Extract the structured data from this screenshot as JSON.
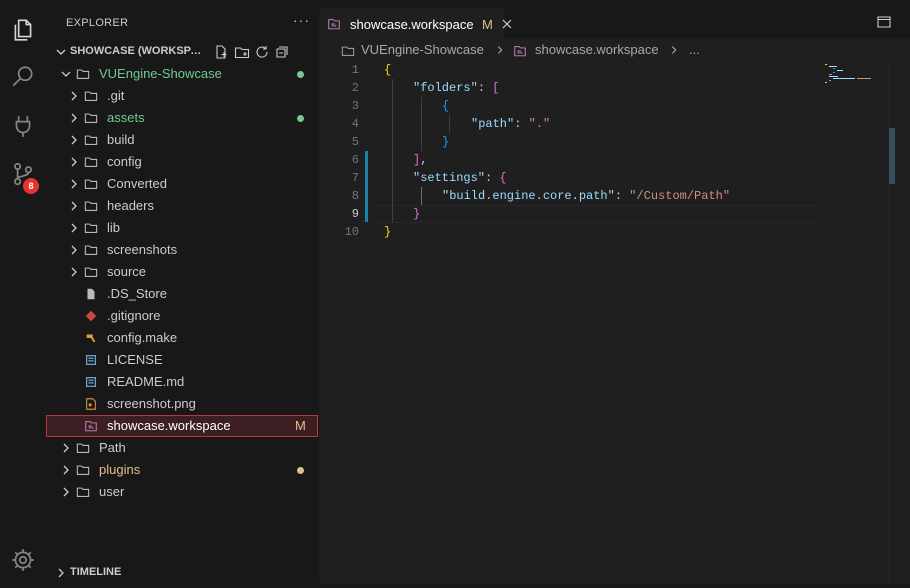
{
  "activity_bar": {
    "icons": [
      "files-icon",
      "search-icon",
      "run-debug-icon",
      "source-control-icon",
      "settings-gear-icon"
    ],
    "source_control_badge": "8"
  },
  "sidebar": {
    "title": "EXPLORER",
    "more": "···",
    "workspace_title": "SHOWCASE (WORKSPACE)",
    "rows": [
      {
        "label": "VUEngine-Showcase",
        "color": "#73c991",
        "dot": "#73c991"
      },
      {
        "label": ".git"
      },
      {
        "label": "assets",
        "color": "#73c991",
        "dot": "#73c991"
      },
      {
        "label": "build"
      },
      {
        "label": "config"
      },
      {
        "label": "Converted"
      },
      {
        "label": "headers"
      },
      {
        "label": "lib"
      },
      {
        "label": "screenshots"
      },
      {
        "label": "source"
      },
      {
        "label": ".DS_Store"
      },
      {
        "label": ".gitignore"
      },
      {
        "label": "config.make"
      },
      {
        "label": "LICENSE"
      },
      {
        "label": "README.md"
      },
      {
        "label": "screenshot.png"
      },
      {
        "label": "showcase.workspace",
        "badge": "M"
      },
      {
        "label": "Path"
      },
      {
        "label": "plugins",
        "color": "#e2c08d",
        "dot": "#e2c08d"
      },
      {
        "label": "user"
      }
    ],
    "timeline": "TIMELINE"
  },
  "editor": {
    "tab": {
      "label": "showcase.workspace",
      "modified": "M"
    },
    "breadcrumb": [
      "VUEngine-Showcase",
      "showcase.workspace",
      "..."
    ],
    "line_numbers": [
      "1",
      "2",
      "3",
      "4",
      "5",
      "6",
      "7",
      "8",
      "9",
      "10"
    ],
    "code": {
      "l1_open": "{",
      "l2_key": "\"folders\"",
      "l2_colon": ": ",
      "l2_bracket": "[",
      "l3_open": "{",
      "l4_key": "\"path\"",
      "l4_colon": ": ",
      "l4_val": "\".\"",
      "l5_close": "}",
      "l6_bracket": "]",
      "l6_comma": ",",
      "l7_key": "\"settings\"",
      "l7_colon": ": ",
      "l7_open": "{",
      "l8_key": "\"build.engine.core.path\"",
      "l8_colon": ": ",
      "l8_val": "\"/Custom/Path\"",
      "l9_close": "}",
      "l10_close": "}"
    }
  }
}
